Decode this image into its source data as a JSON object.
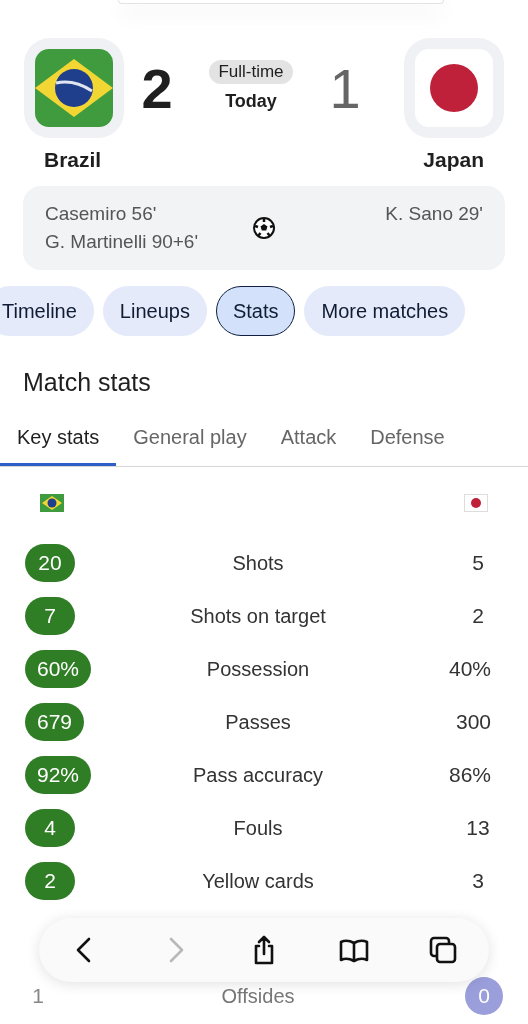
{
  "match": {
    "home": {
      "name": "Brazil",
      "score": "2",
      "kind": "brazil",
      "winner": true
    },
    "away": {
      "name": "Japan",
      "score": "1",
      "kind": "japan",
      "winner": false
    },
    "status": "Full-time",
    "date": "Today"
  },
  "scorers": {
    "home": [
      "Casemiro 56'",
      "G. Martinelli 90+6'"
    ],
    "away": [
      "K. Sano 29'"
    ]
  },
  "chips": [
    {
      "label": "Timeline",
      "selected": false
    },
    {
      "label": "Lineups",
      "selected": false
    },
    {
      "label": "Stats",
      "selected": true
    },
    {
      "label": "More matches",
      "selected": false
    }
  ],
  "section_title": "Match stats",
  "tabs": [
    {
      "label": "Key stats",
      "selected": true
    },
    {
      "label": "General play",
      "selected": false
    },
    {
      "label": "Attack",
      "selected": false
    },
    {
      "label": "Defense",
      "selected": false
    }
  ],
  "stats": [
    {
      "label": "Shots",
      "home": "20",
      "away": "5",
      "home_leads": true,
      "away_leads": false
    },
    {
      "label": "Shots on target",
      "home": "7",
      "away": "2",
      "home_leads": true,
      "away_leads": false
    },
    {
      "label": "Possession",
      "home": "60%",
      "away": "40%",
      "home_leads": true,
      "away_leads": false
    },
    {
      "label": "Passes",
      "home": "679",
      "away": "300",
      "home_leads": true,
      "away_leads": false
    },
    {
      "label": "Pass accuracy",
      "home": "92%",
      "away": "86%",
      "home_leads": true,
      "away_leads": false
    },
    {
      "label": "Fouls",
      "home": "4",
      "away": "13",
      "home_leads": true,
      "away_leads": false
    },
    {
      "label": "Yellow cards",
      "home": "2",
      "away": "3",
      "home_leads": true,
      "away_leads": false
    },
    {
      "label": "Offsides",
      "home": "1",
      "away": "0",
      "home_leads": false,
      "away_leads": true
    }
  ],
  "toolbar": [
    {
      "kind": "back",
      "disabled": false
    },
    {
      "kind": "forward",
      "disabled": true
    },
    {
      "kind": "share",
      "disabled": false
    },
    {
      "kind": "bookmarks",
      "disabled": false
    },
    {
      "kind": "tabs",
      "disabled": false
    }
  ]
}
